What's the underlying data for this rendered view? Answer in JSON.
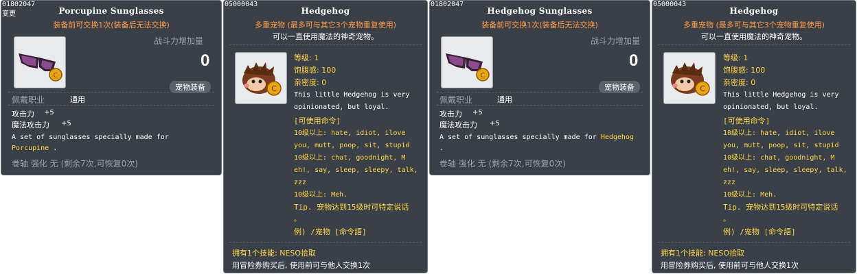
{
  "card1": {
    "id": "01802047",
    "sub": "变更",
    "title": "Porcupine Sunglasses",
    "trade_note": "装备前可交换1次(装备后无法交换)",
    "power_label": "战斗力增加量",
    "power_value": "0",
    "badge": "宠物装备",
    "job_label": "佩戴职业",
    "job_value": "通用",
    "stat1_label": "攻击力",
    "stat1_value": "+5",
    "stat2_label": "魔法攻击力",
    "stat2_value": "+5",
    "desc_line1": "A set of sunglasses specially made for",
    "desc_line2_pre": "Porcupine",
    "desc_line2_post": ".",
    "scroll": "卷轴 强化 无 (剩余7次,可恢复0次)",
    "icon": "sunglasses-icon"
  },
  "card2": {
    "id": "05000043",
    "title": "Hedgehog",
    "multi_note": "多重宠物 (最多可与其它3个宠物重复使用)",
    "magic_note": "可以一直使用魔法的神奇宠物。",
    "level": "等级: 1",
    "fullness": "饱腹感: 100",
    "closeness": "亲密度: 0",
    "desc_line1": "This little Hedgehog is very",
    "desc_line2": "opinionated, but loyal.",
    "cmd_header": "[可使用命令]",
    "cmd1a": "10级以上: hate, idiot, ilove",
    "cmd1b": "you, mutt, poop, sit, stupid",
    "cmd2a": "10级以上: chat, goodnight, M",
    "cmd2b": "eh!, say, sleep, sleepy, talk,",
    "cmd2c": "zzz",
    "cmd3": "10级以上: Meh.",
    "tip1": "Tip. 宠物达到15级时可特定说话",
    "tip2": "。",
    "example": "例) /宠物 [命令語]",
    "skill": "拥有1个技能: NESO拾取",
    "trade": "用冒险券购买后, 使用前可与他人交换1次",
    "icon": "hedgehog-icon"
  },
  "card3": {
    "id": "01802047",
    "title": "Hedgehog Sunglasses",
    "trade_note": "装备前可交换1次(装备后无法交换)",
    "power_label": "战斗力增加量",
    "power_value": "0",
    "badge": "宠物装备",
    "job_label": "佩戴职业",
    "job_value": "通用",
    "stat1_label": "攻击力",
    "stat1_value": "+5",
    "stat2_label": "魔法攻击力",
    "stat2_value": "+5",
    "desc_line1_pre": "A set of sunglasses specially made for",
    "desc_line1_hl": "Hedgehog",
    "desc_line2": ".",
    "scroll": "卷轴 强化 无 (剩余7次,可恢复0次)",
    "icon": "sunglasses-icon"
  },
  "card4": {
    "id": "05000043",
    "title": "Hedgehog",
    "multi_note": "多重宠物 (最多可与其它3个宠物重复使用)",
    "magic_note": "可以一直使用魔法的神奇宠物。",
    "level": "等级: 1",
    "fullness": "饱腹感: 100",
    "closeness": "亲密度: 0",
    "desc_line1": "This little Hedgehog is very",
    "desc_line2": "opinionated, but loyal.",
    "cmd_header": "[可使用命令]",
    "cmd1a": "10级以上: hate, idiot, ilove",
    "cmd1b": "you, mutt, poop, sit, stupid",
    "cmd2a": "10级以上: chat, goodnight, M",
    "cmd2b": "eh!, say, sleep, sleepy, talk,",
    "cmd2c": "zzz",
    "cmd3": "10级以上: Meh.",
    "tip1": "Tip. 宠物达到15级时可特定说话",
    "tip2": "。",
    "example": "例) /宠物 [命令語]",
    "skill": "拥有1个技能: NESO拾取",
    "trade": "用冒险券购买后, 使用前可与他人交换1次",
    "icon": "hedgehog-icon"
  }
}
